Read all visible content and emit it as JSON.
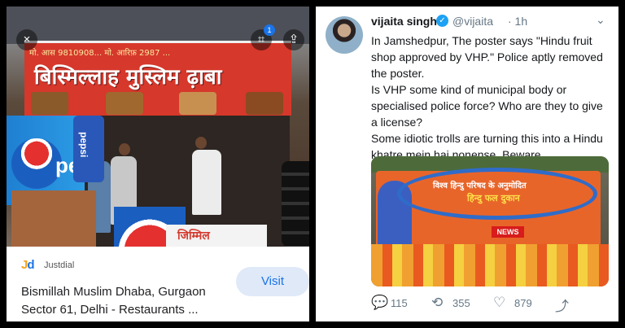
{
  "left_panel": {
    "photo": {
      "sign_top": "मो. आस 9810908... मो. आरिफ़ 2987 ...",
      "sign_title": "बिस्मिल्लाह मुस्लिम ढ़ाबा",
      "pepsi_text": "pe",
      "pepsi_stand_text": "pepsi",
      "bench_text": "जिम्मिल"
    },
    "controls": {
      "close_icon": "×",
      "lens_icon": "⌗",
      "lens_badge": "1",
      "share_icon": "⇪"
    },
    "result": {
      "source_logo_j": "J",
      "source_logo_d": "d",
      "source_name": "Justdial",
      "title": "Bismillah Muslim Dhaba, Gurgaon Sector 61, Delhi - Restaurants ...",
      "visit_label": "Visit"
    }
  },
  "tweet": {
    "name": "vijaita singh",
    "verified_icon": "✓",
    "handle": "@vijaita",
    "time": "· 1h",
    "caret_icon": "⌄",
    "paragraphs": [
      "In Jamshedpur, The poster says \"Hindu fruit shop approved by VHP.\" Police aptly removed the poster.",
      "Is VHP some kind of municipal body or specialised police force? Who are they to give a license?",
      "Some idiotic trolls are turning this into a Hindu khatre mein hai nonense. Beware."
    ],
    "photo": {
      "banner_line1": "विश्व हिन्दु परिषद के अनुमोदित",
      "banner_line2": "हिन्दु फल दुकान",
      "news_tag": "NEWS"
    },
    "actions": {
      "reply_icon": "💬",
      "reply_count": "115",
      "retweet_icon": "⟲",
      "retweet_count": "355",
      "like_icon": "♡",
      "like_count": "879",
      "share_icon": "⤴"
    }
  },
  "colors": {
    "accent": "#1a73e8",
    "twitter_blue": "#1da1f2",
    "sign_red": "#d6382b",
    "banner_orange": "#e8652a"
  }
}
